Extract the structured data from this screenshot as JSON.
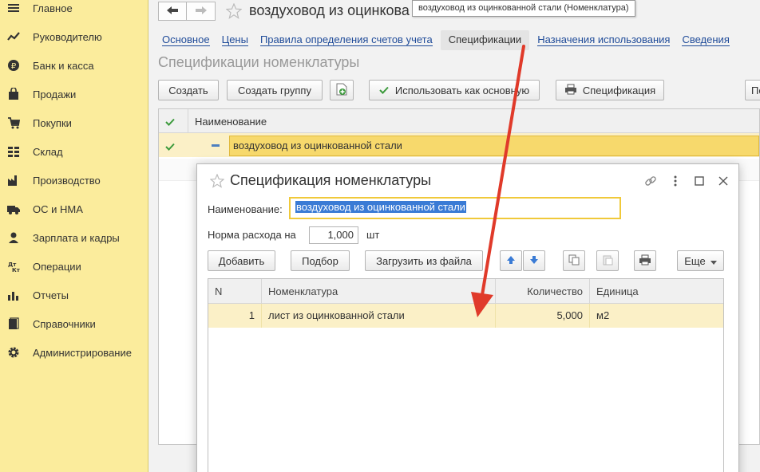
{
  "sidebar": {
    "items": [
      {
        "label": "Главное",
        "icon": "menu-icon"
      },
      {
        "label": "Руководителю",
        "icon": "trend-icon"
      },
      {
        "label": "Банк и касса",
        "icon": "ruble-coin-icon"
      },
      {
        "label": "Продажи",
        "icon": "shopping-bag-icon"
      },
      {
        "label": "Покупки",
        "icon": "cart-icon"
      },
      {
        "label": "Склад",
        "icon": "warehouse-grid-icon"
      },
      {
        "label": "Производство",
        "icon": "factory-icon"
      },
      {
        "label": "ОС и НМА",
        "icon": "truck-icon"
      },
      {
        "label": "Зарплата и кадры",
        "icon": "person-icon"
      },
      {
        "label": "Операции",
        "icon": "dt-kt-icon"
      },
      {
        "label": "Отчеты",
        "icon": "bar-chart-icon"
      },
      {
        "label": "Справочники",
        "icon": "books-icon"
      },
      {
        "label": "Администрирование",
        "icon": "gear-icon"
      }
    ]
  },
  "header": {
    "title": "воздуховод из оцинкова",
    "tooltip": "воздуховод из оцинкованной стали (Номенклатура)"
  },
  "tabs": [
    {
      "label": "Основное",
      "active": false
    },
    {
      "label": "Цены",
      "active": false
    },
    {
      "label": "Правила определения счетов учета",
      "active": false
    },
    {
      "label": "Спецификации",
      "active": true
    },
    {
      "label": "Назначения использования",
      "active": false
    },
    {
      "label": "Сведения",
      "active": false
    }
  ],
  "section_title": "Спецификации номенклатуры",
  "toolbar": {
    "create": "Создать",
    "create_group": "Создать группу",
    "use_as_main": "Использовать как основную",
    "specification": "Спецификация",
    "more_stub": "По"
  },
  "list": {
    "header_name": "Наименование",
    "row_name": "воздуховод из оцинкованной стали"
  },
  "dialog": {
    "title": "Спецификация номенклатуры",
    "name_label": "Наименование:",
    "name_value": "воздуховод из оцинкованной стали",
    "norm_label": "Норма расхода на",
    "norm_value": "1,000",
    "norm_unit": "шт",
    "buttons": {
      "add": "Добавить",
      "pick": "Подбор",
      "load": "Загрузить из файла",
      "more": "Еще"
    },
    "grid": {
      "columns": [
        "N",
        "Номенклатура",
        "Количество",
        "Единица"
      ],
      "rows": [
        {
          "n": "1",
          "item": "лист из оцинкованной стали",
          "qty": "5,000",
          "unit": "м2"
        }
      ]
    }
  },
  "colors": {
    "sidebar_bg": "#fbec9c",
    "selected_row": "#fbf0c7",
    "highlight": "#f7d96c",
    "link": "#1f4b99",
    "arrow": "#e03a2a",
    "check_green": "#3c9a3c"
  }
}
